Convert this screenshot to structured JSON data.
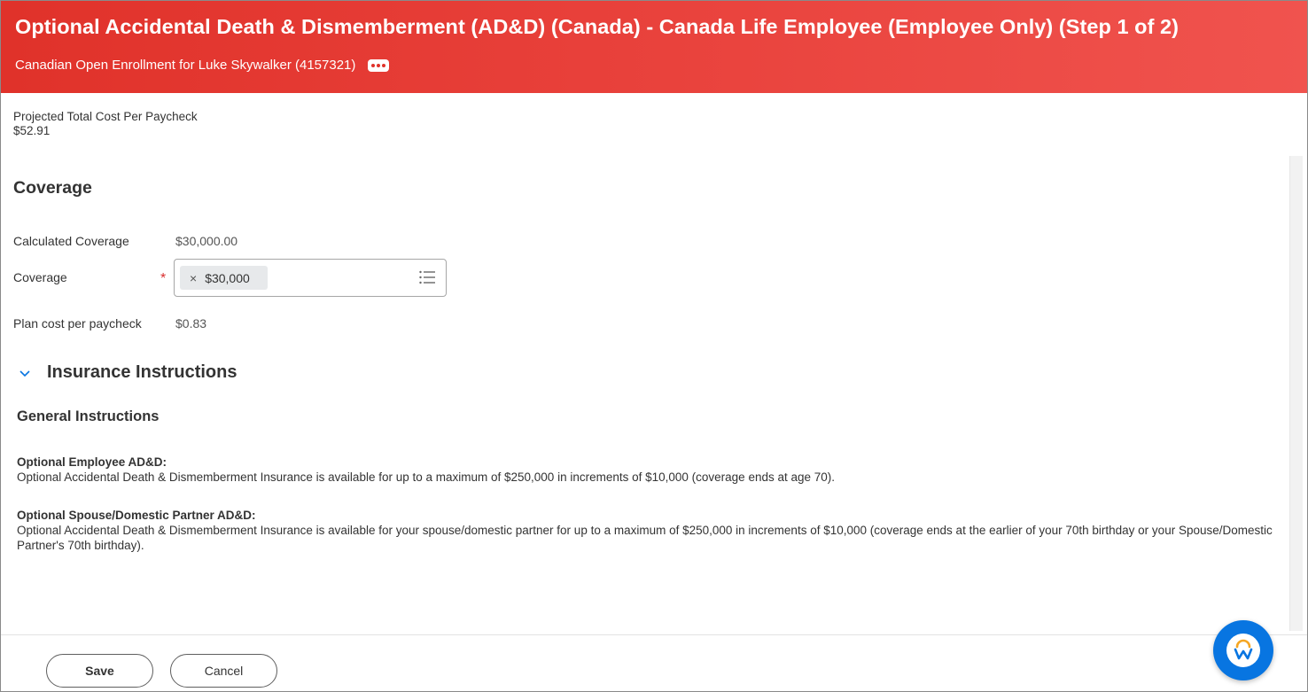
{
  "header": {
    "title": "Optional Accidental Death & Dismemberment (AD&D) (Canada) - Canada Life Employee (Employee Only) (Step 1 of 2)",
    "subtitle": "Canadian Open Enrollment for Luke Skywalker (4157321)",
    "more_icon": "ellipsis-icon",
    "color": "#e0322a"
  },
  "projected": {
    "label": "Projected Total Cost Per Paycheck",
    "value": "$52.91"
  },
  "coverage": {
    "title": "Coverage",
    "calculated_label": "Calculated Coverage",
    "calculated_value": "$30,000.00",
    "coverage_label": "Coverage",
    "required_mark": "*",
    "selected_value": "$30,000",
    "remove_glyph": "×",
    "list_icon": "list-icon",
    "plan_cost_label": "Plan cost per paycheck",
    "plan_cost_value": "$0.83"
  },
  "insurance": {
    "title": "Insurance Instructions",
    "expanded": true,
    "general_title": "General Instructions",
    "items": [
      {
        "heading": "Optional Employee AD&D:",
        "text": "Optional Accidental Death & Dismemberment Insurance is available for up to a maximum of $250,000 in increments of $10,000 (coverage ends at age 70)."
      },
      {
        "heading": "Optional Spouse/Domestic Partner AD&D:",
        "text": "Optional Accidental Death & Dismemberment Insurance is available for your spouse/domestic partner for up to a maximum of $250,000 in increments of $10,000 (coverage ends at the earlier of your 70th birthday or your Spouse/Domestic Partner's 70th birthday)."
      }
    ]
  },
  "footer": {
    "save_label": "Save",
    "cancel_label": "Cancel",
    "highlight_color": "#fdf93a"
  },
  "assistant": {
    "icon": "workday-assistant-icon",
    "color": "#0875e1"
  }
}
